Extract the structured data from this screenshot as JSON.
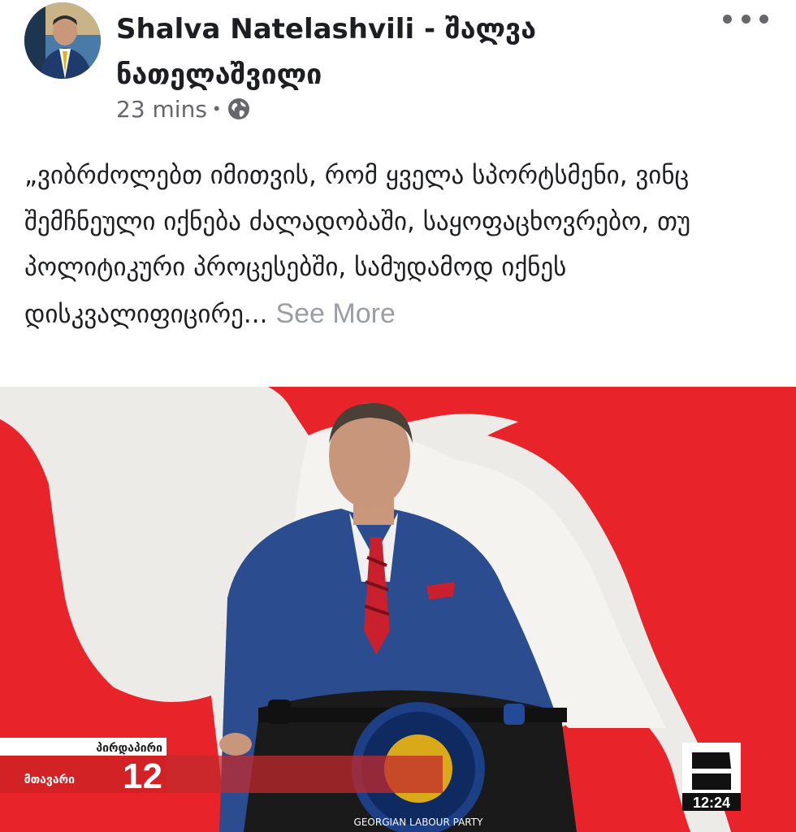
{
  "post": {
    "author_name": "Shalva Natelashvili -  შალვა ნათელაშვილი",
    "timestamp": "23 mins",
    "separator": "•",
    "privacy_icon": "globe-icon",
    "text": "„ვიბრძოლებთ იმითვის, რომ ყველა სპორტსმენი, ვინც შემჩნეული იქნება ძალადობაში, საყოფაცხოვრებო, თუ პოლიტიკური პროცესებში, სამუდამოდ იქნეს დისკვალიფიცირე...",
    "see_more": "See More",
    "more_icon": "more-horizontal-icon"
  },
  "photo": {
    "ticker_top_label": "პირდაპირი",
    "ticker_bottom_label": "მთავარი",
    "ticker_number": "12",
    "channel_time": "12:24",
    "podium_text": "GEORGIAN LABOUR PARTY",
    "colors": {
      "flag_red": "#e8242a",
      "suit_blue": "#2b4d8f",
      "tie_red": "#c8202c"
    }
  }
}
